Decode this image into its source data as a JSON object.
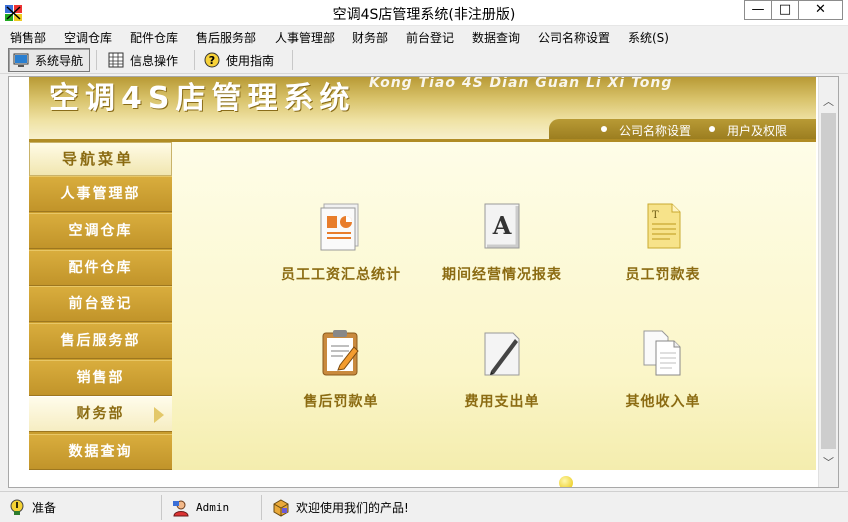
{
  "window": {
    "title": "空调4S店管理系统(非注册版)",
    "minimize": "—",
    "maximize": "□",
    "close": "✕"
  },
  "menu": [
    "销售部",
    "空调仓库",
    "配件仓库",
    "售后服务部",
    "人事管理部",
    "财务部",
    "前台登记",
    "数据查询",
    "公司名称设置",
    "系统(S)"
  ],
  "toolbar": {
    "nav": "系统导航",
    "info": "信息操作",
    "guide": "使用指南"
  },
  "banner": {
    "title": "空调4S店管理系统",
    "subtitle": "Kong Tiao 4S Dian Guan Li Xi Tong",
    "links": [
      "公司名称设置",
      "用户及权限"
    ]
  },
  "sidebar": {
    "heading": "导航菜单",
    "items": [
      {
        "label": "人事管理部",
        "active": false
      },
      {
        "label": "空调仓库",
        "active": false
      },
      {
        "label": "配件仓库",
        "active": false
      },
      {
        "label": "前台登记",
        "active": false
      },
      {
        "label": "售后服务部",
        "active": false
      },
      {
        "label": "销售部",
        "active": false
      },
      {
        "label": "财务部",
        "active": true
      },
      {
        "label": "数据查询",
        "active": false
      }
    ]
  },
  "features": [
    {
      "label": "员工工资汇总统计",
      "icon": "presentation-chart-icon"
    },
    {
      "label": "期间经营情况报表",
      "icon": "font-letter-a-icon"
    },
    {
      "label": "员工罚款表",
      "icon": "text-document-icon"
    },
    {
      "label": "售后罚款单",
      "icon": "clipboard-edit-icon"
    },
    {
      "label": "费用支出单",
      "icon": "pen-paper-icon"
    },
    {
      "label": "其他收入单",
      "icon": "copy-documents-icon"
    }
  ],
  "status": {
    "ready": "准备",
    "user": "Admin",
    "welcome": "欢迎使用我们的产品!"
  },
  "colors": {
    "gold": "#c99d2e",
    "gold_dark": "#8b6b12",
    "panel_bg": "#fbf6c9"
  }
}
